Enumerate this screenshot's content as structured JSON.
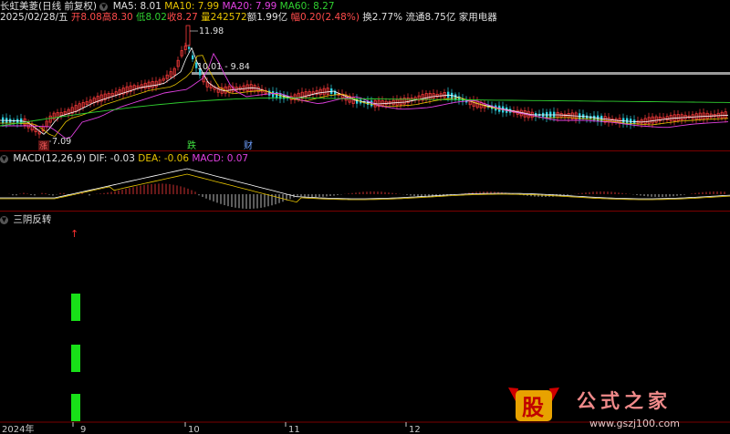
{
  "info": {
    "title": "长虹美菱(日线 前复权)",
    "ma5": "MA5: 8.01",
    "ma10": "MA10: 7.99",
    "ma20": "MA20: 7.99",
    "ma60": "MA60: 8.27",
    "date": "2025/02/28/五",
    "open": "开8.08",
    "high": "高8.30",
    "low": "低8.02",
    "close": "收8.27",
    "volume": "量242572",
    "amount": "额1.99亿",
    "change": "幅0.20(2.48%)",
    "turnover": "换2.77%",
    "float_cap": "流通8.75亿",
    "industry": "家用电器"
  },
  "annotations": {
    "high": "11.98",
    "low": "7.09",
    "range": "10.01 - 9.84",
    "zhang": "涨",
    "die": "跌",
    "cai": "财"
  },
  "macd": {
    "label": "MACD(12,26,9)",
    "dif": "DIF: -0.03",
    "dea": "DEA: -0.06",
    "macd": "MACD: 0.07"
  },
  "indicator": {
    "name": "三阴反转"
  },
  "xaxis": [
    "2024年",
    "9",
    "10",
    "11",
    "12"
  ],
  "watermark": {
    "stock": "股",
    "brand": "公式之家",
    "url": "www.gszj100.com"
  },
  "colors": {
    "up": "#ff3c3c",
    "down": "#30d0e0",
    "ma5": "#ffffff",
    "ma10": "#e6c300",
    "ma20": "#e040e0",
    "ma60": "#30d030",
    "signal": "#18e018"
  }
}
